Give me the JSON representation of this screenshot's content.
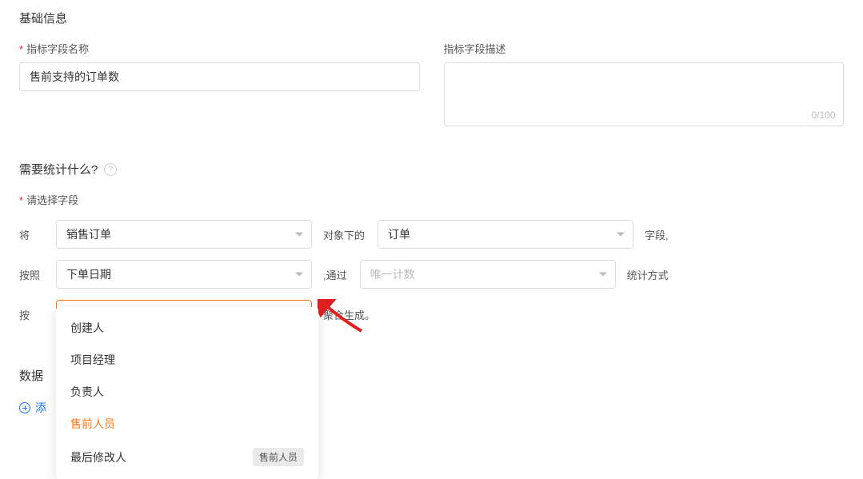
{
  "section1": {
    "title": "基础信息",
    "name_label": "指标字段名称",
    "name_value": "售前支持的订单数",
    "desc_label": "指标字段描述",
    "desc_value": "",
    "counter": "0/100"
  },
  "section2": {
    "title": "需要统计什么?",
    "sub_label": "请选择字段",
    "row1": {
      "prefix": "将",
      "select1": "销售订单",
      "mid": "对象下的",
      "select2": "订单",
      "suffix": "字段,"
    },
    "row2": {
      "prefix": "按照",
      "select1": "下单日期",
      "mid": ",通过",
      "select2_placeholder": "唯一计数",
      "suffix": "统计方式"
    },
    "row3": {
      "prefix": "按",
      "select1_placeholder": "售前人员",
      "suffix": "聚合生成。"
    }
  },
  "dropdown": {
    "items": [
      "创建人",
      "项目经理",
      "负责人",
      "售前人员",
      "最后修改人"
    ],
    "selected": "售前人员",
    "tooltip": "售前人员"
  },
  "section3": {
    "title": "数据",
    "add_link": "添"
  }
}
